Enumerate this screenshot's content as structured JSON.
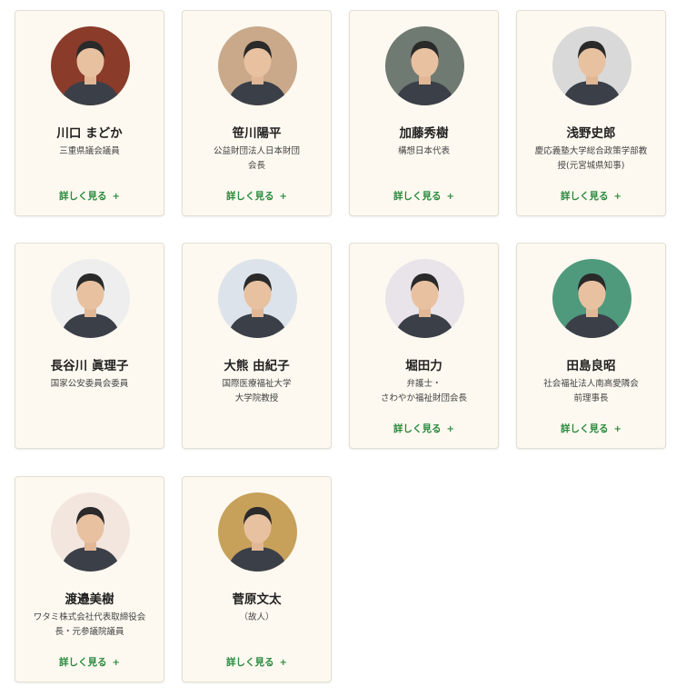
{
  "more_label": "詳しく見る",
  "plus_glyph": "+",
  "colors": {
    "card_bg": "#fdf9f0",
    "link_green": "#2a8a3e",
    "border": "#e5dfd2"
  },
  "members": [
    {
      "name": "川口 まどか",
      "role": "三重県議会議員",
      "has_more": true,
      "photo_bg": "#8a3b2a"
    },
    {
      "name": "笹川陽平",
      "role": "公益財団法人日本財団\n会長",
      "has_more": true,
      "photo_bg": "#c9a98a"
    },
    {
      "name": "加藤秀樹",
      "role": "構想日本代表",
      "has_more": true,
      "photo_bg": "#6f7a72"
    },
    {
      "name": "浅野史郎",
      "role": "慶応義塾大学総合政策学部教\n授(元宮城県知事)",
      "has_more": true,
      "photo_bg": "#d9d9d9"
    },
    {
      "name": "長谷川 眞理子",
      "role": "国家公安委員会委員",
      "has_more": false,
      "photo_bg": "#eeeeee"
    },
    {
      "name": "大熊 由紀子",
      "role": "国際医療福祉大学\n大学院教授",
      "has_more": false,
      "photo_bg": "#dde3ea"
    },
    {
      "name": "堀田力",
      "role": "弁護士・\nさわやか福祉財団会長",
      "has_more": true,
      "photo_bg": "#e9e4ea"
    },
    {
      "name": "田島良昭",
      "role": "社会福祉法人南高愛隣会\n前理事長",
      "has_more": true,
      "photo_bg": "#4f9a7d"
    },
    {
      "name": "渡邉美樹",
      "role": "ワタミ株式会社代表取締役会\n長・元参議院議員",
      "has_more": true,
      "photo_bg": "#f3e6de"
    },
    {
      "name": "菅原文太",
      "role": "（故人）",
      "has_more": true,
      "photo_bg": "#c7a15a"
    }
  ]
}
